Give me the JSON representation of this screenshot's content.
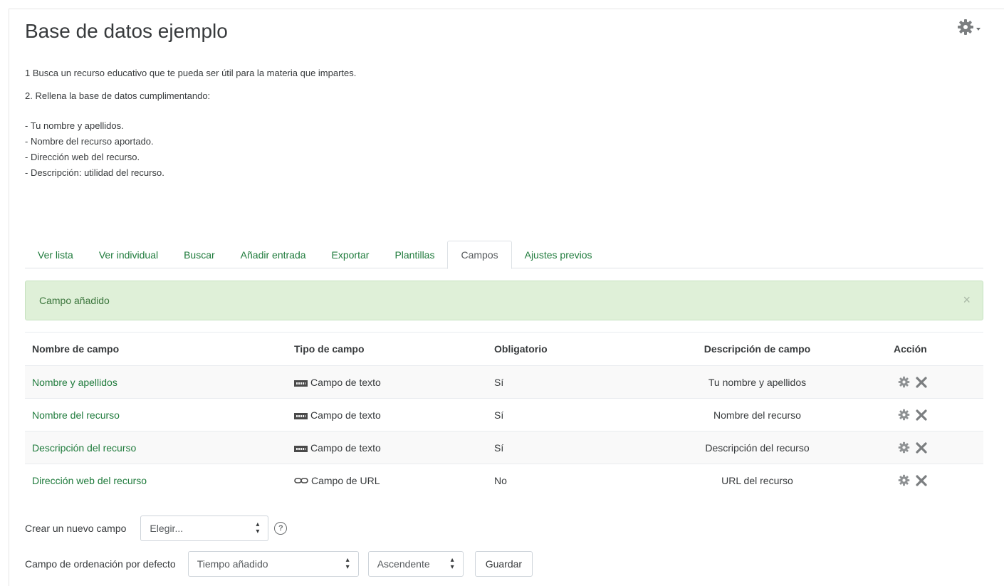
{
  "page": {
    "title": "Base de datos ejemplo",
    "gear_menu_icon": "gear-icon"
  },
  "intro": {
    "step1": "1  Busca un recurso educativo que te pueda ser útil para la materia que impartes.",
    "step2": "2. Rellena la base de datos cumplimentando:",
    "bullets": [
      "- Tu nombre y apellidos.",
      "- Nombre del recurso aportado.",
      "- Dirección web del recurso.",
      "- Descripción: utilidad del recurso."
    ]
  },
  "tabs": [
    {
      "label": "Ver lista",
      "active": false
    },
    {
      "label": "Ver individual",
      "active": false
    },
    {
      "label": "Buscar",
      "active": false
    },
    {
      "label": "Añadir entrada",
      "active": false
    },
    {
      "label": "Exportar",
      "active": false
    },
    {
      "label": "Plantillas",
      "active": false
    },
    {
      "label": "Campos",
      "active": true
    },
    {
      "label": "Ajustes previos",
      "active": false
    }
  ],
  "alert": {
    "message": "Campo añadido",
    "close_label": "×"
  },
  "table": {
    "headers": {
      "name": "Nombre de campo",
      "type": "Tipo de campo",
      "required": "Obligatorio",
      "description": "Descripción de campo",
      "action": "Acción"
    },
    "rows": [
      {
        "name": "Nombre y apellidos",
        "type_icon": "text-field-icon",
        "type": "Campo de texto",
        "required": "Sí",
        "description": "Tu nombre y apellidos"
      },
      {
        "name": "Nombre del recurso",
        "type_icon": "text-field-icon",
        "type": "Campo de texto",
        "required": "Sí",
        "description": "Nombre del recurso"
      },
      {
        "name": "Descripción del recurso",
        "type_icon": "text-field-icon",
        "type": "Campo de texto",
        "required": "Sí",
        "description": "Descripción del recurso"
      },
      {
        "name": "Dirección web del recurso",
        "type_icon": "link-icon",
        "type": "Campo de URL",
        "required": "No",
        "description": "URL del recurso"
      }
    ]
  },
  "new_field": {
    "label": "Crear un nuevo campo",
    "select_value": "Elegir..."
  },
  "sort": {
    "label": "Campo de ordenación por defecto",
    "field_value": "Tiempo añadido",
    "order_value": "Ascendente",
    "save_label": "Guardar"
  },
  "colors": {
    "link_green": "#1f7b3c",
    "alert_bg": "#dff0d8",
    "alert_text": "#3c763d"
  }
}
